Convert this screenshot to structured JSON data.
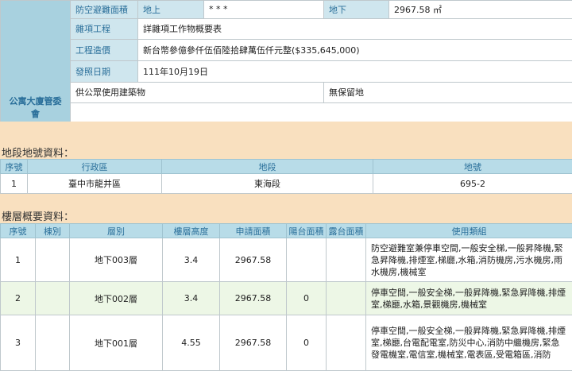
{
  "building": {
    "shelter_area_label": "防空避難面積",
    "above_label": "地上",
    "above_value": "* * *",
    "below_label": "地下",
    "below_value": "2967.58 ㎡",
    "misc_label": "雜項工程",
    "misc_value": "詳雜項工作物概要表",
    "cost_label": "工程造價",
    "cost_value": "新台幣參億參仟伍佰陸拾肆萬伍仟元整($335,645,000)",
    "issue_label": "發照日期",
    "issue_value": "111年10月19日",
    "public_use": "供公眾使用建築物",
    "reserve": "無保留地",
    "committee_label": "公寓大廈管委會"
  },
  "land": {
    "title": "地段地號資料：",
    "headers": [
      "序號",
      "行政區",
      "地段",
      "地號"
    ],
    "rows": [
      {
        "seq": "1",
        "district": "臺中市龍井區",
        "section": "東海段",
        "number": "695-2"
      }
    ]
  },
  "floors": {
    "title": "樓層概要資料：",
    "headers": [
      "序號",
      "棟別",
      "層別",
      "樓層高度",
      "申請面積",
      "陽台面積",
      "露台面積",
      "使用類組"
    ],
    "rows": [
      {
        "seq": "1",
        "bldg": "",
        "floor": "地下003層",
        "height": "3.4",
        "area": "2967.58",
        "balcony": "",
        "terrace": "",
        "use": "防空避難室兼停車空間,一般安全梯,一般昇降機,緊急昇降機,排煙室,梯廳,水箱,消防機房,污水機房,雨水機房,機械室"
      },
      {
        "seq": "2",
        "bldg": "",
        "floor": "地下002層",
        "height": "3.4",
        "area": "2967.58",
        "balcony": "0",
        "terrace": "",
        "use": "停車空間,一般安全梯,一般昇降機,緊急昇降機,排煙室,梯廳,水箱,景觀機房,機械室"
      },
      {
        "seq": "3",
        "bldg": "",
        "floor": "地下001層",
        "height": "4.55",
        "area": "2967.58",
        "balcony": "0",
        "terrace": "",
        "use": "停車空間,一般安全梯,一般昇降機,緊急昇降機,排煙室,梯廳,台電配電室,防災中心,消防中繼機房,緊急發電機室,電信室,機械室,電表區,受電箱區,消防"
      }
    ]
  }
}
